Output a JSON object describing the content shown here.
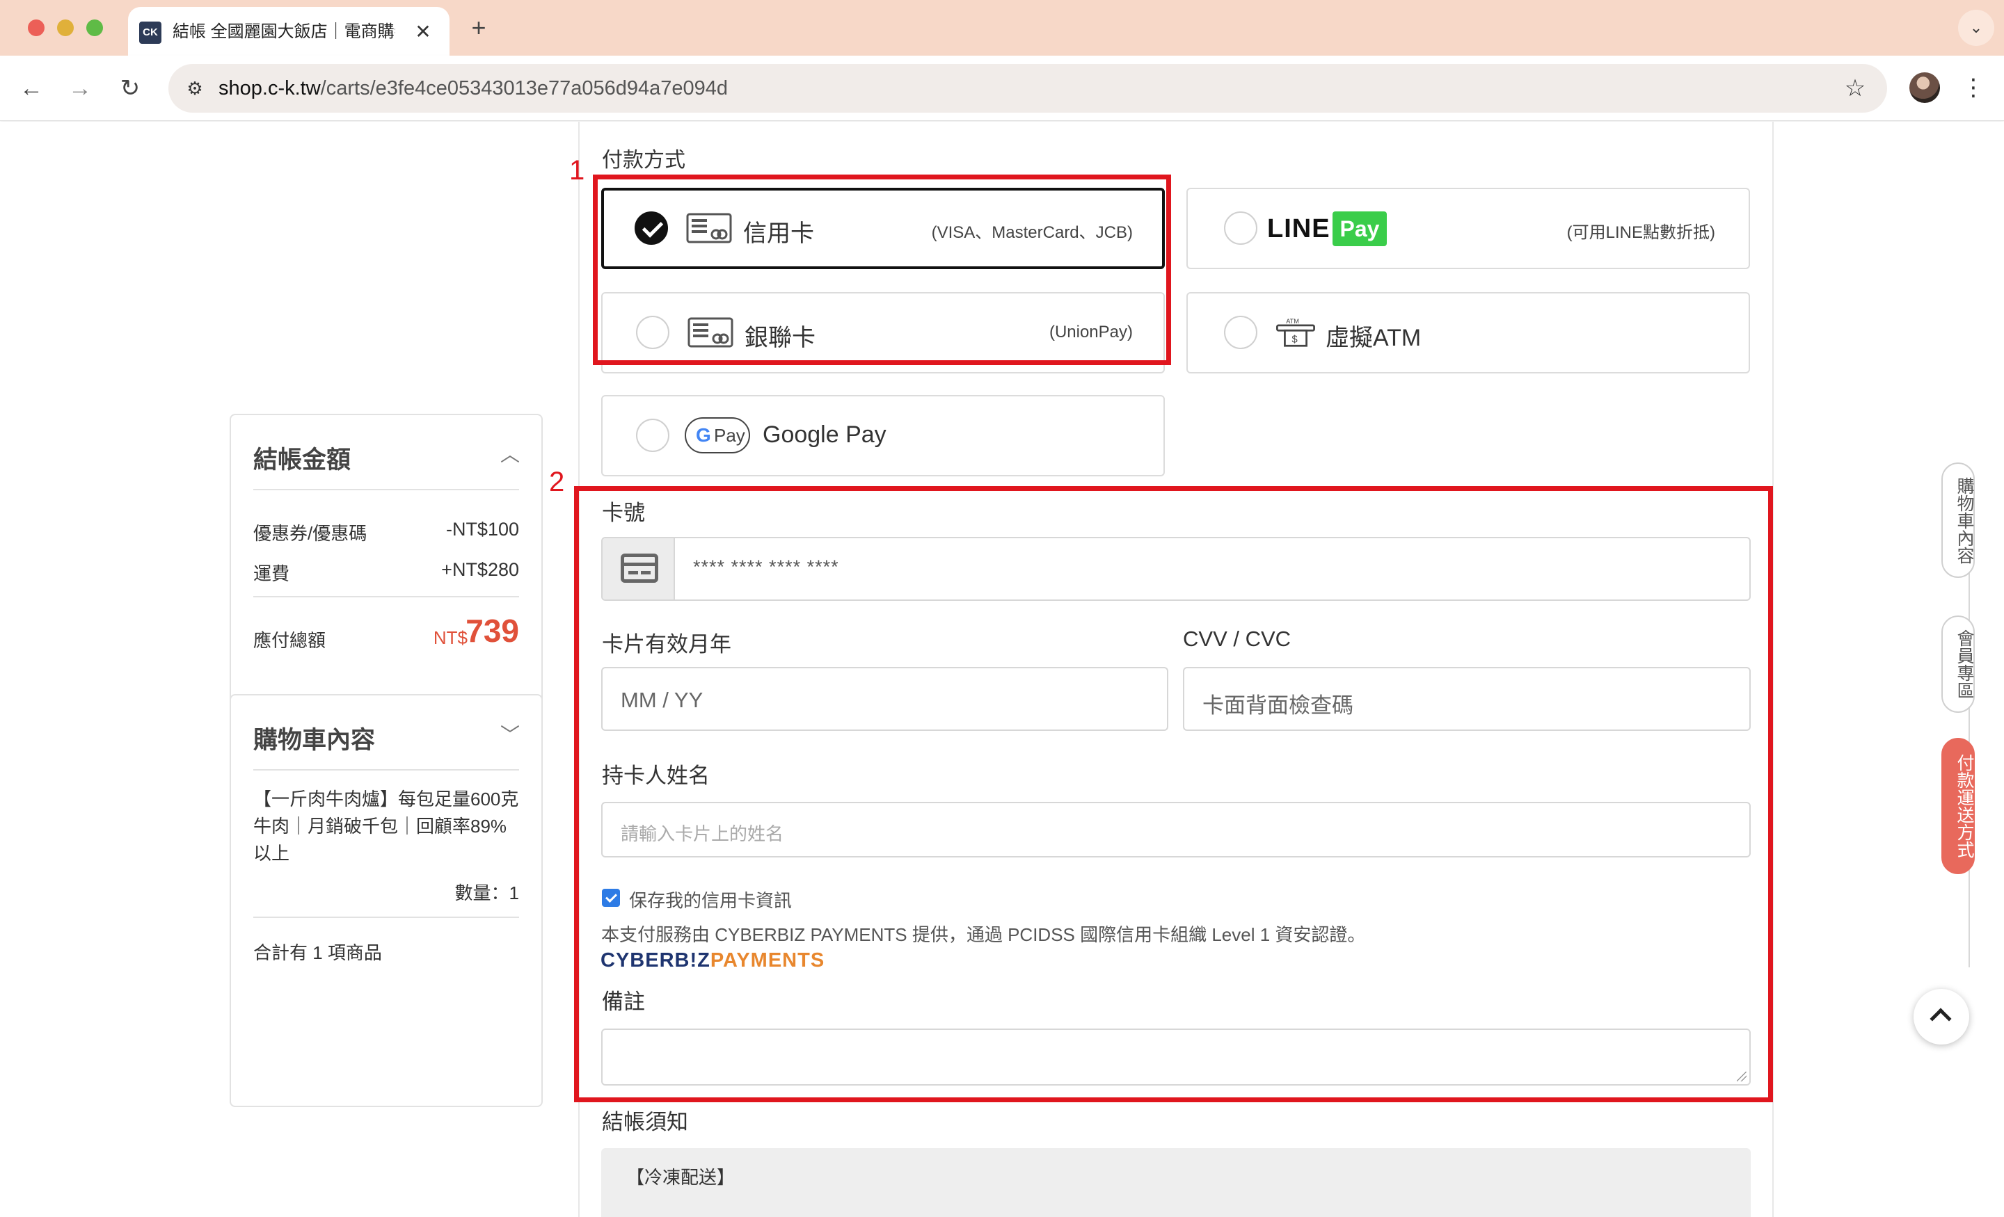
{
  "browser": {
    "tab_favicon": "CK",
    "tab_title": "結帳 全國麗園大飯店｜電商購物",
    "tab_close": "✕",
    "new_tab": "+",
    "tab_menu": "⌄",
    "url_host": "shop.c-k.tw",
    "url_path": "/carts/e3fe4ce05343013e77a056d94a7e094d",
    "icons": [
      "back-arrow-icon",
      "forward-arrow-icon",
      "reload-icon",
      "site-info-icon",
      "bookmark-star-icon",
      "kebab-menu-icon"
    ]
  },
  "summary": {
    "title": "結帳金額",
    "rows": [
      {
        "label": "優惠券/優惠碼",
        "value": "-NT$100"
      },
      {
        "label": "運費",
        "value": "+NT$280"
      }
    ],
    "total_label": "應付總額",
    "total_currency": "NT$",
    "total_amount": "739"
  },
  "cart": {
    "title": "購物車內容",
    "item_name": "【一斤肉牛肉爐】每包足量600克牛肉｜月銷破千包｜回顧率89%以上",
    "quantity": "數量：1",
    "count_text": "合計有 1 項商品"
  },
  "payment": {
    "section_label": "付款方式",
    "methods": [
      {
        "label": "信用卡",
        "note": "(VISA、MasterCard、JCB)",
        "selected": true
      },
      {
        "label": "銀聯卡",
        "note": "(UnionPay)",
        "selected": false
      },
      {
        "label": "Google Pay",
        "badge_g": "G",
        "badge_pay": "Pay",
        "selected": false
      },
      {
        "logo_line": "LINE",
        "logo_pay": "Pay",
        "note": "(可用LINE點數折抵)",
        "selected": false
      },
      {
        "label": "虛擬ATM",
        "selected": false
      }
    ]
  },
  "annotations": {
    "box1_number": "1",
    "box2_number": "2",
    "color": "#e0161e"
  },
  "card_form": {
    "card_number_label": "卡號",
    "card_number_placeholder": "**** **** **** ****",
    "expiry_label": "卡片有效月年",
    "expiry_placeholder": "MM / YY",
    "cvv_label": "CVV / CVC",
    "cvv_placeholder": "卡面背面檢查碼",
    "holder_label": "持卡人姓名",
    "holder_placeholder": "請輸入卡片上的姓名",
    "save_card_label": "保存我的信用卡資訊",
    "save_card_checked": true,
    "provider_note": "本支付服務由 CYBERBIZ PAYMENTS 提供，通過 PCIDSS 國際信用卡組織 Level 1 資安認證。",
    "provider_logo_a": "CYBERB!Z",
    "provider_logo_b": "PAYMENTS"
  },
  "memo": {
    "label": "備註"
  },
  "notice": {
    "label": "結帳須知",
    "text": "【冷凍配送】"
  },
  "side_nav": [
    {
      "label": "購物車內容",
      "active": false
    },
    {
      "label": "會員專區",
      "active": false
    },
    {
      "label": "付款運送方式",
      "active": true
    }
  ],
  "colors": {
    "accent_red": "#e0513a",
    "side_active": "#e8695c",
    "checkbox_blue": "#2d7be5",
    "linepay_green": "#3acd4a"
  }
}
